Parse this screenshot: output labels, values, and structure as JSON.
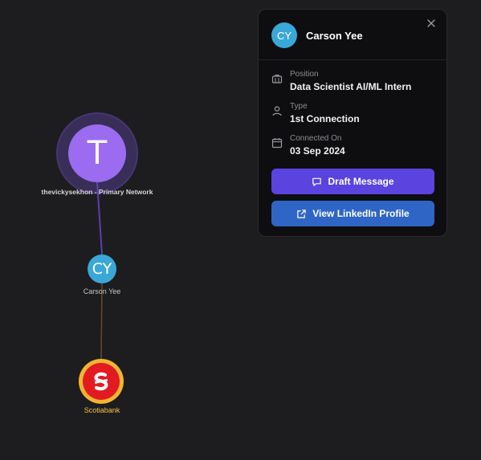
{
  "graph": {
    "primary_node": {
      "initial": "T",
      "label": "thevickysekhon - Primary Network",
      "color": "#9b6cf0"
    },
    "person_node": {
      "initials": "CY",
      "label": "Carson Yee",
      "color": "#3aa8d6"
    },
    "company_node": {
      "label": "Scotiabank",
      "logo_icon": "scotiabank-logo-icon",
      "color": "#e21b23",
      "ring_color": "#f2b531"
    },
    "edge_colors": {
      "primary_to_person": "#5a3fb0",
      "person_to_company": "#6b4a2a"
    }
  },
  "panel": {
    "avatar_initials": "CY",
    "name": "Carson Yee",
    "close_icon": "close-icon",
    "position_label": "Position",
    "position_value": "Data Scientist AI/ML Intern",
    "type_label": "Type",
    "type_value": "1st Connection",
    "connected_label": "Connected On",
    "connected_value": "03 Sep 2024",
    "draft_button_label": "Draft Message",
    "linkedin_button_label": "View LinkedIn Profile",
    "colors": {
      "draft_button": "#5b43e0",
      "linkedin_button": "#2f66c6"
    }
  }
}
